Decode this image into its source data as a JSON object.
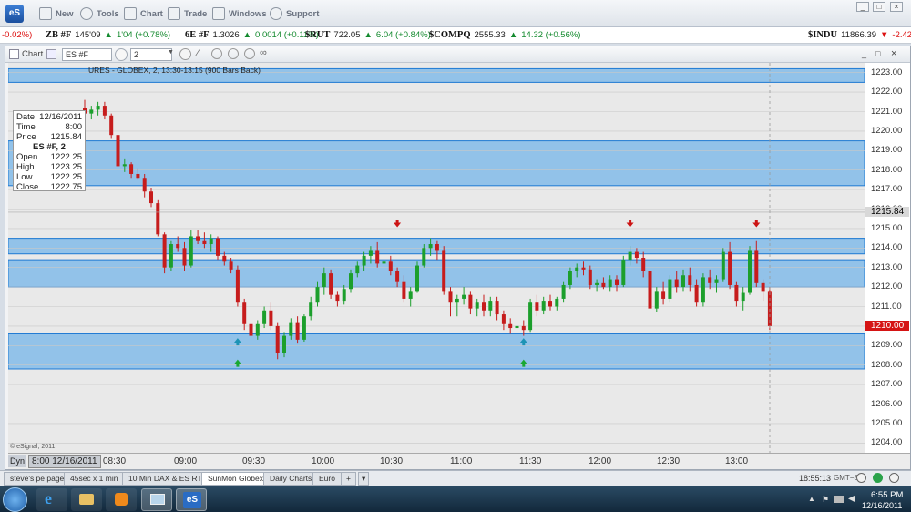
{
  "toolbar": {
    "app_logo": "eS",
    "buttons": [
      {
        "label": "New",
        "icon": "new-icon"
      },
      {
        "label": "Tools",
        "icon": "tools-icon"
      },
      {
        "label": "Chart",
        "icon": "chart-icon"
      },
      {
        "label": "Trade",
        "icon": "trade-icon"
      },
      {
        "label": "Windows",
        "icon": "windows-icon"
      },
      {
        "label": "Support",
        "icon": "support-icon"
      }
    ]
  },
  "ticker": {
    "items": [
      {
        "symbol": "",
        "last": "",
        "change": "-0.02%)",
        "dir": "dn"
      },
      {
        "symbol": "ZB #F",
        "last": "145'09",
        "change": "1'04 (+0.78%)",
        "dir": "up"
      },
      {
        "symbol": "6E #F",
        "last": "1.3026",
        "change": "0.0014 (+0.11%)",
        "dir": "up"
      },
      {
        "symbol": "$RUT",
        "last": "722.05",
        "change": "6.04 (+0.84%)",
        "dir": "up"
      },
      {
        "symbol": "$COMPQ",
        "last": "2555.33",
        "change": "14.32 (+0.56%)",
        "dir": "up"
      },
      {
        "symbol": "$INDU",
        "last": "11866.39",
        "change": "-2.42 (",
        "dir": "dn"
      }
    ]
  },
  "chart_window": {
    "title": "Chart",
    "symbol_field": "ES #F",
    "interval_field": "2",
    "chart_caption": "URES - GLOBEX, 2, 13:30-13:15 (900 Bars Back)",
    "watermark": "© eSignal, 2011",
    "dyn_label": "Dyn",
    "cursor_time_label": "8:00 12/16/2011"
  },
  "infobox": {
    "date_label": "Date",
    "date": "12/16/2011",
    "time_label": "Time",
    "time": "8:00",
    "price_label": "Price",
    "price": "1215.84",
    "symbol": "ES #F, 2",
    "open_label": "Open",
    "open": "1222.25",
    "high_label": "High",
    "high": "1223.25",
    "low_label": "Low",
    "low": "1222.25",
    "close_label": "Close",
    "close": "1222.75"
  },
  "chart_data": {
    "type": "candlestick",
    "ylim": [
      1203.5,
      1223.5
    ],
    "y_ticks": [
      "1223.00",
      "1222.00",
      "1221.00",
      "1220.00",
      "1219.00",
      "1218.00",
      "1217.00",
      "1216.00",
      "1215.00",
      "1214.00",
      "1213.00",
      "1212.00",
      "1211.00",
      "1210.00",
      "1209.00",
      "1208.00",
      "1207.00",
      "1206.00",
      "1205.00",
      "1204.00"
    ],
    "x_ticks": [
      "08:30",
      "09:00",
      "09:30",
      "10:00",
      "10:30",
      "11:00",
      "11:30",
      "12:00",
      "12:30",
      "13:00"
    ],
    "crosshair_price_label": "1215.84",
    "last_price_label": "1210.00",
    "last_price": 1210.0,
    "zones": [
      {
        "from": 1222.5,
        "to": 1223.2
      },
      {
        "from": 1217.2,
        "to": 1219.5
      },
      {
        "from": 1213.7,
        "to": 1214.5
      },
      {
        "from": 1212.0,
        "to": 1213.4
      },
      {
        "from": 1207.8,
        "to": 1209.6
      }
    ],
    "candles": [
      [
        1221.2,
        1221.6,
        1220.9,
        1220.9
      ],
      [
        1220.9,
        1221.3,
        1220.6,
        1221.1
      ],
      [
        1221.1,
        1221.5,
        1220.8,
        1221.3
      ],
      [
        1221.3,
        1221.5,
        1220.6,
        1220.8
      ],
      [
        1220.8,
        1220.9,
        1219.6,
        1219.8
      ],
      [
        1219.8,
        1219.9,
        1218.0,
        1218.2
      ],
      [
        1218.2,
        1218.6,
        1217.9,
        1218.3
      ],
      [
        1218.3,
        1218.4,
        1217.6,
        1217.8
      ],
      [
        1217.8,
        1218.1,
        1217.5,
        1217.6
      ],
      [
        1217.6,
        1217.8,
        1216.6,
        1216.9
      ],
      [
        1216.9,
        1217.1,
        1216.1,
        1216.3
      ],
      [
        1216.3,
        1216.5,
        1214.6,
        1214.7
      ],
      [
        1214.7,
        1214.8,
        1212.7,
        1213.0
      ],
      [
        1213.0,
        1214.4,
        1212.8,
        1214.2
      ],
      [
        1214.2,
        1214.6,
        1213.8,
        1214.0
      ],
      [
        1214.0,
        1214.3,
        1212.8,
        1213.1
      ],
      [
        1213.1,
        1214.9,
        1213.0,
        1214.6
      ],
      [
        1214.6,
        1214.9,
        1214.2,
        1214.4
      ],
      [
        1214.4,
        1214.8,
        1214.0,
        1214.2
      ],
      [
        1214.2,
        1214.7,
        1213.8,
        1214.5
      ],
      [
        1214.5,
        1214.6,
        1213.4,
        1213.6
      ],
      [
        1213.6,
        1213.8,
        1213.1,
        1213.3
      ],
      [
        1213.3,
        1213.5,
        1212.7,
        1212.9
      ],
      [
        1212.9,
        1213.1,
        1211.0,
        1211.2
      ],
      [
        1211.2,
        1211.4,
        1209.8,
        1210.1
      ],
      [
        1210.1,
        1210.5,
        1209.2,
        1209.5
      ],
      [
        1209.5,
        1210.3,
        1209.3,
        1210.1
      ],
      [
        1210.1,
        1211.0,
        1209.9,
        1210.8
      ],
      [
        1210.8,
        1211.2,
        1209.8,
        1210.0
      ],
      [
        1210.0,
        1210.2,
        1208.3,
        1208.6
      ],
      [
        1208.6,
        1209.7,
        1208.4,
        1209.5
      ],
      [
        1209.5,
        1210.4,
        1209.3,
        1210.2
      ],
      [
        1210.2,
        1210.5,
        1209.1,
        1209.3
      ],
      [
        1209.3,
        1210.6,
        1209.2,
        1210.5
      ],
      [
        1210.5,
        1211.5,
        1210.3,
        1211.2
      ],
      [
        1211.2,
        1212.3,
        1211.0,
        1212.0
      ],
      [
        1212.0,
        1213.0,
        1211.6,
        1212.7
      ],
      [
        1212.7,
        1212.9,
        1211.4,
        1211.6
      ],
      [
        1211.6,
        1211.8,
        1211.0,
        1211.3
      ],
      [
        1211.3,
        1212.1,
        1211.1,
        1211.9
      ],
      [
        1211.9,
        1212.9,
        1211.7,
        1212.7
      ],
      [
        1212.7,
        1213.3,
        1212.5,
        1213.1
      ],
      [
        1213.1,
        1213.8,
        1212.8,
        1213.6
      ],
      [
        1213.6,
        1214.1,
        1213.2,
        1213.9
      ],
      [
        1213.9,
        1214.3,
        1213.0,
        1213.2
      ],
      [
        1213.2,
        1213.5,
        1212.9,
        1213.3
      ],
      [
        1213.3,
        1213.6,
        1212.6,
        1212.8
      ],
      [
        1212.8,
        1213.0,
        1212.0,
        1212.3
      ],
      [
        1212.3,
        1212.6,
        1211.2,
        1211.4
      ],
      [
        1211.4,
        1212.0,
        1211.0,
        1211.8
      ],
      [
        1211.8,
        1213.3,
        1211.7,
        1213.1
      ],
      [
        1213.1,
        1214.2,
        1213.0,
        1214.0
      ],
      [
        1214.0,
        1214.5,
        1213.6,
        1214.2
      ],
      [
        1214.2,
        1214.4,
        1213.4,
        1213.9
      ],
      [
        1213.9,
        1214.1,
        1211.6,
        1211.8
      ],
      [
        1211.8,
        1212.0,
        1210.5,
        1211.2
      ],
      [
        1211.2,
        1211.6,
        1210.5,
        1211.4
      ],
      [
        1211.4,
        1212.0,
        1211.1,
        1211.6
      ],
      [
        1211.6,
        1211.8,
        1210.6,
        1210.9
      ],
      [
        1210.9,
        1211.4,
        1210.5,
        1211.2
      ],
      [
        1211.2,
        1211.6,
        1210.5,
        1210.8
      ],
      [
        1210.8,
        1211.5,
        1210.5,
        1211.3
      ],
      [
        1211.3,
        1211.5,
        1210.3,
        1210.6
      ],
      [
        1210.6,
        1210.8,
        1209.8,
        1210.1
      ],
      [
        1210.1,
        1210.4,
        1209.6,
        1209.9
      ],
      [
        1209.9,
        1210.2,
        1209.4,
        1210.0
      ],
      [
        1210.0,
        1210.3,
        1209.5,
        1209.8
      ],
      [
        1209.8,
        1211.4,
        1209.7,
        1211.2
      ],
      [
        1211.2,
        1211.6,
        1210.5,
        1210.8
      ],
      [
        1210.8,
        1211.5,
        1210.6,
        1211.3
      ],
      [
        1211.3,
        1211.6,
        1210.8,
        1211.0
      ],
      [
        1211.0,
        1211.5,
        1210.8,
        1211.4
      ],
      [
        1211.4,
        1212.3,
        1211.2,
        1212.1
      ],
      [
        1212.1,
        1213.0,
        1211.9,
        1212.8
      ],
      [
        1212.8,
        1213.2,
        1212.5,
        1213.0
      ],
      [
        1213.0,
        1213.3,
        1212.6,
        1212.9
      ],
      [
        1212.9,
        1213.1,
        1211.9,
        1212.1
      ],
      [
        1212.1,
        1212.4,
        1211.8,
        1212.2
      ],
      [
        1212.2,
        1212.5,
        1211.9,
        1212.0
      ],
      [
        1212.0,
        1212.6,
        1211.8,
        1212.4
      ],
      [
        1212.4,
        1212.6,
        1211.8,
        1212.1
      ],
      [
        1212.1,
        1213.6,
        1212.0,
        1213.4
      ],
      [
        1213.4,
        1214.1,
        1213.1,
        1213.8
      ],
      [
        1213.8,
        1214.0,
        1213.2,
        1213.5
      ],
      [
        1213.5,
        1213.8,
        1212.5,
        1212.8
      ],
      [
        1212.8,
        1213.0,
        1210.6,
        1210.9
      ],
      [
        1210.9,
        1212.0,
        1210.7,
        1211.8
      ],
      [
        1211.8,
        1212.3,
        1211.1,
        1211.4
      ],
      [
        1211.4,
        1212.6,
        1211.2,
        1212.4
      ],
      [
        1212.4,
        1212.8,
        1211.7,
        1212.0
      ],
      [
        1212.0,
        1212.9,
        1211.8,
        1212.6
      ],
      [
        1212.6,
        1213.0,
        1211.8,
        1212.1
      ],
      [
        1212.1,
        1212.4,
        1211.0,
        1211.2
      ],
      [
        1211.2,
        1212.7,
        1211.0,
        1212.5
      ],
      [
        1212.5,
        1212.9,
        1211.9,
        1212.2
      ],
      [
        1212.2,
        1212.6,
        1211.7,
        1212.4
      ],
      [
        1212.4,
        1214.0,
        1212.3,
        1213.8
      ],
      [
        1213.8,
        1214.3,
        1211.9,
        1212.1
      ],
      [
        1212.1,
        1212.3,
        1211.0,
        1211.3
      ],
      [
        1211.3,
        1212.0,
        1210.8,
        1211.7
      ],
      [
        1211.7,
        1214.1,
        1211.6,
        1213.9
      ],
      [
        1213.9,
        1214.4,
        1212.0,
        1212.2
      ],
      [
        1212.2,
        1212.4,
        1211.3,
        1211.8
      ],
      [
        1211.8,
        1212.0,
        1209.8,
        1210.0
      ]
    ],
    "arrows": [
      {
        "bar": 23,
        "price": 1208.05,
        "dir": "up",
        "color": "#1aa832"
      },
      {
        "bar": 23,
        "price": 1209.15,
        "dir": "up",
        "color": "#1d93b5"
      },
      {
        "bar": 66,
        "price": 1208.05,
        "dir": "up",
        "color": "#1aa832"
      },
      {
        "bar": 66,
        "price": 1209.15,
        "dir": "up",
        "color": "#1d93b5"
      },
      {
        "bar": 47,
        "price": 1215.3,
        "dir": "down",
        "color": "#cc1414"
      },
      {
        "bar": 82,
        "price": 1215.3,
        "dir": "down",
        "color": "#cc1414"
      },
      {
        "bar": 101,
        "price": 1215.3,
        "dir": "down",
        "color": "#cc1414"
      }
    ]
  },
  "tabs": [
    {
      "label": "steve's pe page",
      "active": false
    },
    {
      "label": "45sec x 1 min",
      "active": false
    },
    {
      "label": "10 Min DAX & ES RTH",
      "active": false
    },
    {
      "label": "SunMon Globex*",
      "active": true
    },
    {
      "label": "Daily Charts",
      "active": false
    },
    {
      "label": "Euro",
      "active": false
    }
  ],
  "status": {
    "time": "18:55:13",
    "tz": "GMT−8"
  },
  "taskbar": {
    "clock_time": "6:55 PM",
    "clock_date": "12/16/2011"
  }
}
